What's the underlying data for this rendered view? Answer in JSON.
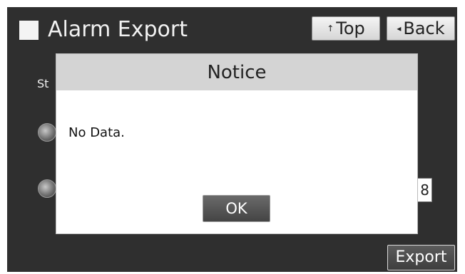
{
  "header": {
    "title": "Alarm Export",
    "top_button": {
      "glyph": "↑",
      "label": "Top"
    },
    "back_button": {
      "glyph": "◂",
      "label": "Back"
    }
  },
  "background": {
    "partial_label": "St",
    "number_value": "8",
    "export_label": "Export"
  },
  "dialog": {
    "title": "Notice",
    "message": "No Data.",
    "ok_label": "OK"
  }
}
